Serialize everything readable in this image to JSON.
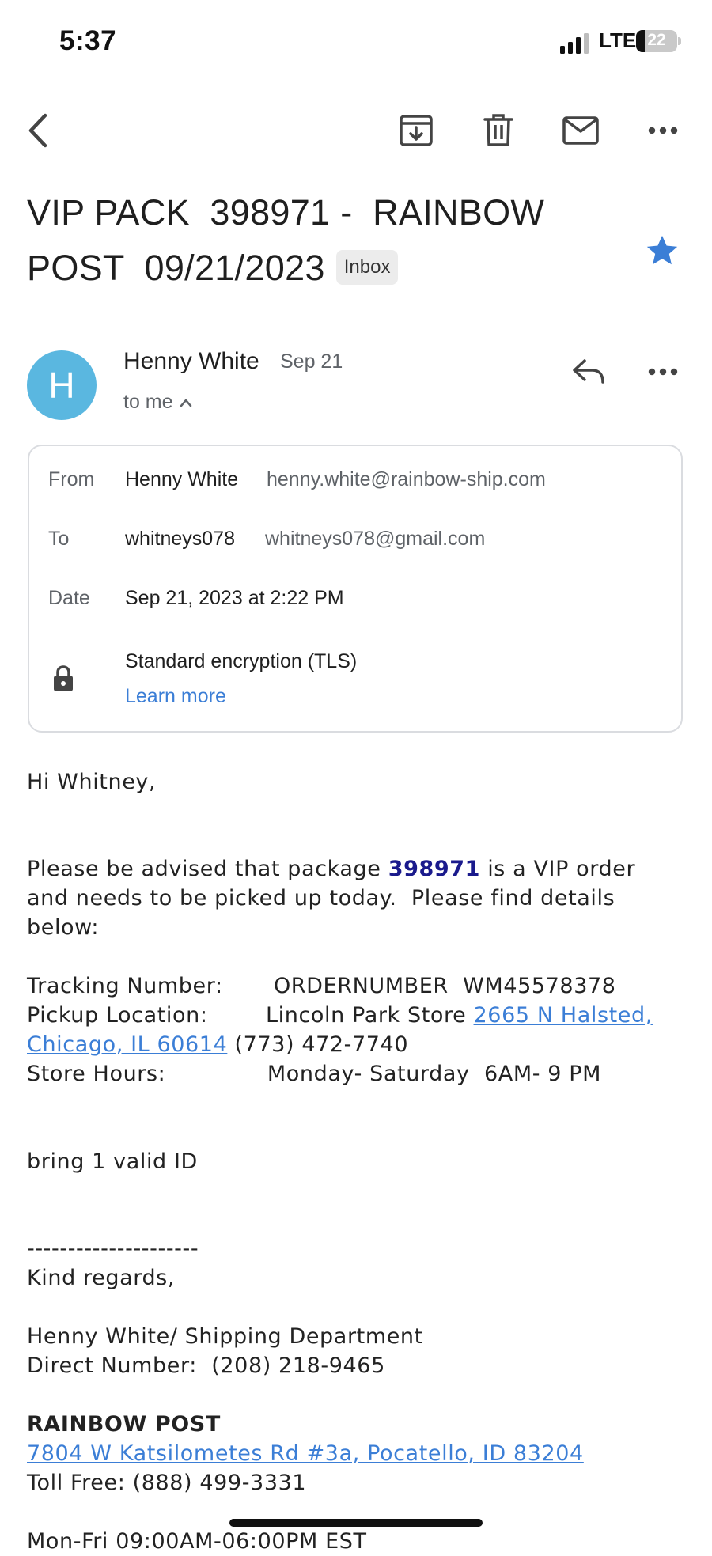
{
  "status_bar": {
    "time": "5:37",
    "network": "LTE",
    "battery": "22",
    "battery_level_percent": 22
  },
  "toolbar": {
    "back_icon": "chevron-left-icon",
    "archive_icon": "archive-icon",
    "delete_icon": "trash-icon",
    "mark_unread_icon": "mail-icon",
    "more_icon": "more-horizontal-icon"
  },
  "subject": {
    "line1": "VIP PACK  398971 -  RAINBOW",
    "line2": "POST  09/21/2023",
    "label": "Inbox",
    "starred": true,
    "star_color": "#3b7ed6"
  },
  "message_header": {
    "avatar_letter": "H",
    "avatar_color": "#5ab7e0",
    "sender_name": "Henny White",
    "date": "Sep 21",
    "recipient_summary": "to me",
    "reply_icon": "reply-icon",
    "more_icon": "more-horizontal-icon"
  },
  "details": {
    "from_label": "From",
    "from_name": "Henny White",
    "from_email": "henny.white@rainbow-ship.com",
    "to_label": "To",
    "to_name": "whitneys078",
    "to_email": "whitneys078@gmail.com",
    "date_label": "Date",
    "date_value": "Sep 21, 2023 at 2:22 PM",
    "encryption": "Standard encryption (TLS)",
    "learn_more": "Learn more"
  },
  "body": {
    "greeting": "Hi Whitney,",
    "advice_pre": "Please be advised that package ",
    "package_number": "398971",
    "advice_post": " is a VIP order",
    "advice_line2": "and needs to be picked up today.  Please find details",
    "advice_line3": "below:",
    "tracking": "Tracking Number:       ORDERNUMBER  WM45578378",
    "pickup_pre": "Pickup Location:        Lincoln Park Store ",
    "pickup_link_line1": "2665 N Halsted,",
    "pickup_link_line2": "Chicago, IL 60614",
    "pickup_phone": " (773) 472-7740",
    "store_hours": "Store Hours:              Monday- Saturday  6AM- 9 PM",
    "id_note": "bring 1 valid ID",
    "separator": "---------------------",
    "sign_off": "Kind regards,",
    "signature_name": "Henny White/ Shipping Department",
    "direct_number": "Direct Number:  (208) 218-9465",
    "company": "RAINBOW POST",
    "company_address": "7804 W Katsilometes Rd #3a, Pocatello, ID 83204",
    "toll_free": "Toll Free: (888) 499-3331",
    "hours_partial": "Mon-Fri 09:00AM-06:00PM EST"
  }
}
